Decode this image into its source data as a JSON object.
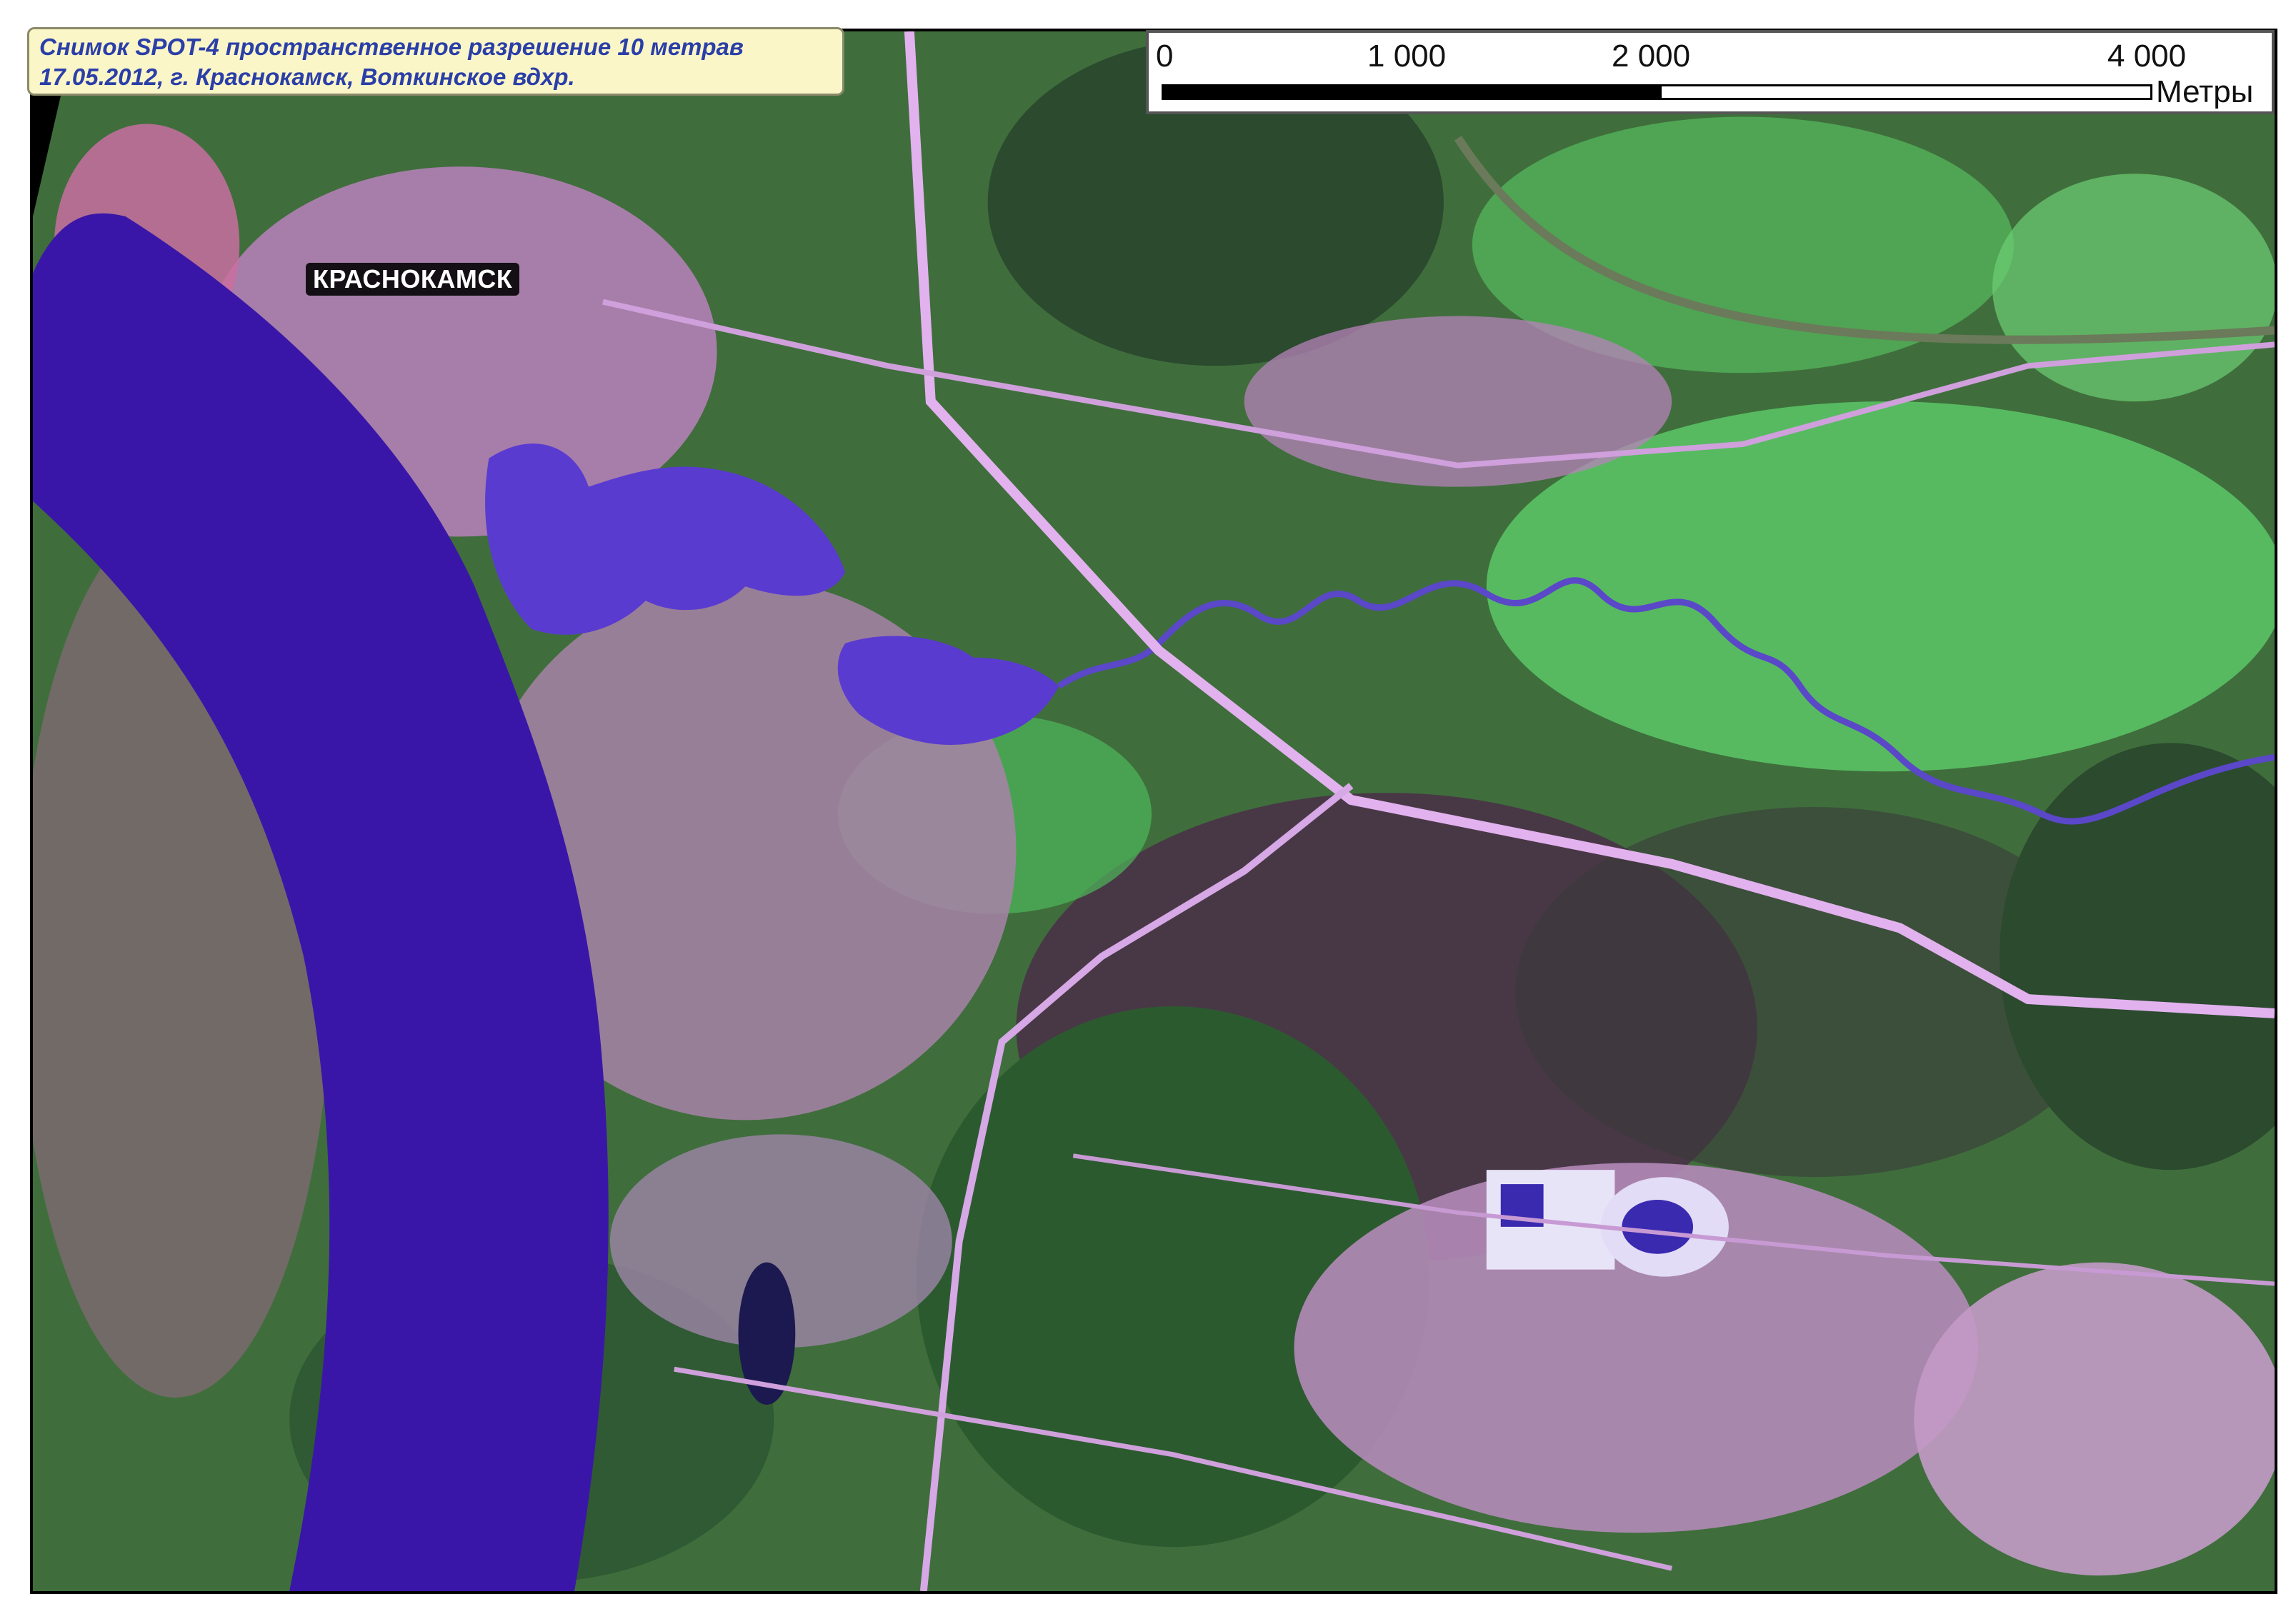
{
  "title": {
    "line1": "Снимок SPOT-4 пространственное разрешение 10 метрав",
    "line2": "17.05.2012, г. Краснокамск, Воткинское вдхр."
  },
  "scale_bar": {
    "ticks": [
      "0",
      "1 000",
      "2 000",
      "4 000"
    ],
    "unit": "Метры"
  },
  "labels": {
    "city": "КРАСНОКАМСК"
  },
  "colors": {
    "water": "#3a16a8",
    "forest": "#2f6a33",
    "field": "#5fd16a",
    "urban": "#c98ad0",
    "road": "#e6b8f2",
    "title_text": "#2b3fa8",
    "title_bg": "#fbf6c8"
  }
}
